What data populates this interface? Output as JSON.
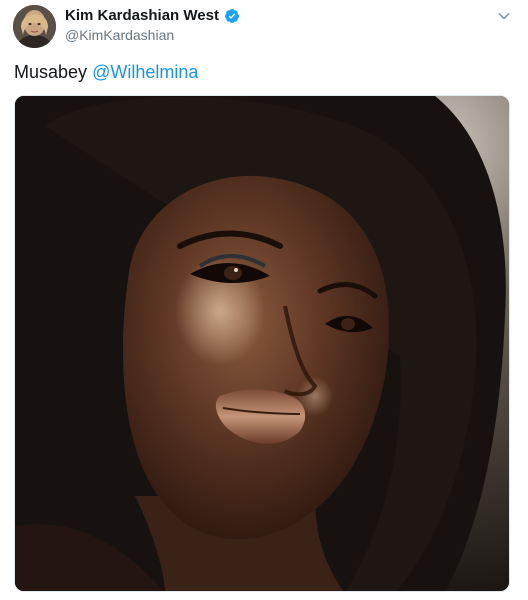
{
  "tweet": {
    "author_name": "Kim Kardashian West",
    "handle": "@KimKardashian",
    "text_plain": "Musabey",
    "text_mention": "@Wilhelmina",
    "verified": true
  },
  "icons": {
    "verified": "verified-badge-icon",
    "more": "chevron-down-icon"
  },
  "colors": {
    "mention": "#1b95e0",
    "verified": "#1da1f2"
  }
}
